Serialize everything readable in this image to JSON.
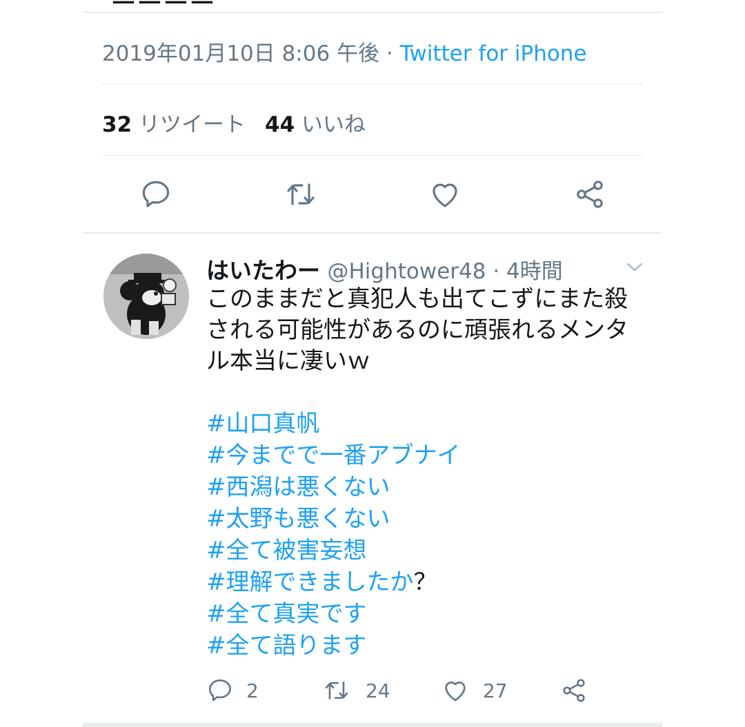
{
  "detail": {
    "timestamp": "2019年01月10日 8:06 午後",
    "separator": " · ",
    "source": "Twitter for iPhone",
    "retweet_count": "32",
    "retweet_label": "リツイート",
    "like_count": "44",
    "like_label": "いいね",
    "actions": [
      "reply-icon",
      "retweet-icon",
      "like-icon",
      "share-icon"
    ]
  },
  "reply": {
    "display_name": "はいたわー",
    "handle_time": "@Hightower48 · 4時間",
    "text": "このままだと真犯人も出てこずにまた殺される可能性があるのに頑張れるメンタル本当に凄いｗ",
    "hashtags": [
      {
        "tag": "#山口真帆",
        "suffix": ""
      },
      {
        "tag": "#今までで一番アブナイ",
        "suffix": ""
      },
      {
        "tag": "#西潟は悪くない",
        "suffix": ""
      },
      {
        "tag": "#太野も悪くない",
        "suffix": ""
      },
      {
        "tag": "#全て被害妄想",
        "suffix": ""
      },
      {
        "tag": "#理解できましたか",
        "suffix": "？"
      },
      {
        "tag": "#全て真実です",
        "suffix": ""
      },
      {
        "tag": "#全て語ります",
        "suffix": ""
      }
    ],
    "reply_count": "2",
    "retweet_count": "24",
    "like_count": "27"
  },
  "colors": {
    "link": "#1da1f2",
    "secondary_text": "#657786",
    "primary_text": "#14171a",
    "divider": "#e1e8ed"
  }
}
